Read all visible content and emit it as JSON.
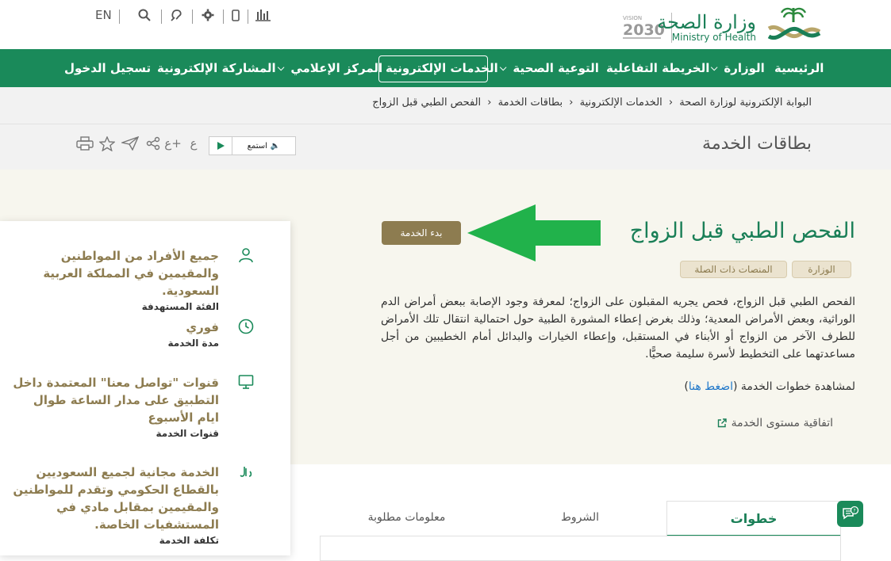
{
  "utility": {
    "lang": "EN",
    "icons": [
      "search-icon",
      "hearing-icon",
      "gear-icon",
      "mobile-icon",
      "stats-icon"
    ]
  },
  "logo": {
    "arabic": "وزارة الصحة",
    "english": "Ministry of Health",
    "vision": "VISION 2030"
  },
  "nav": {
    "items": [
      {
        "label": "الرئيسية"
      },
      {
        "label": "الوزارة"
      },
      {
        "label": "الخريطة التفاعلية"
      },
      {
        "label": "التوعية الصحية"
      },
      {
        "label": "الخدمات الإلكترونية"
      },
      {
        "label": "المركز الإعلامي"
      },
      {
        "label": "المشاركة الإلكترونية"
      },
      {
        "label": "تسجيل الدخول"
      }
    ]
  },
  "breadcrumb": {
    "items": [
      "البوابة الإلكترونية لوزارة الصحة",
      "الخدمات الإلكترونية",
      "بطاقات الخدمة",
      "الفحص الطبي قبل الزواج"
    ],
    "sep": "‹"
  },
  "page": {
    "title": "بطاقات الخدمة",
    "listen_label": "استمع"
  },
  "service": {
    "title": "الفحص الطبي قبل الزواج",
    "start_button": "بدء الخدمة",
    "tags": [
      "الوزارة",
      "المنصات ذات الصلة"
    ],
    "description": "الفحص الطبي قبل الزواج، فحص يجريه المقبلون على الزواج؛ لمعرفة وجود الإصابة ببعض أمراض الدم الوراثية، وبعض الأمراض المعدية؛ وذلك بغرض إعطاء المشورة الطبية حول احتمالية انتقال تلك الأمراض للطرف الآخر من الزواج أو الأبناء في المستقبل، وإعطاء الخيارات والبدائل أمام الخطيبين من أجل مساعدتهما على التخطيط لأسرة سليمة صحيًّا.",
    "steps_prefix": "لمشاهدة خطوات الخدمة (",
    "steps_link": "اضغط هنا",
    "steps_suffix": ")",
    "sla_label": "اتفاقية مستوى الخدمة"
  },
  "sidebar": {
    "items": [
      {
        "value": "جميع الأفراد من المواطنين والمقيمين في المملكة العربية السعودية.",
        "label": "الفئة المستهدفة"
      },
      {
        "value": "فوري",
        "label": "مدة الخدمة"
      },
      {
        "value": "قنوات \"تواصل معنا\" المعتمدة داخل التطبيق على مدار الساعة طوال ايام الأسبوع",
        "label": "قنوات الخدمة"
      },
      {
        "value": "الخدمة مجانية لجميع السعوديين بالقطاع الحكومي وتقدم للمواطنين والمقيمين بمقابل مادي في المستشفيات الخاصة.",
        "label": "تكلفة الخدمة"
      }
    ]
  },
  "tabs": [
    {
      "label": "خطوات"
    },
    {
      "label": "الشروط"
    },
    {
      "label": "معلومات مطلوبة"
    }
  ],
  "colors": {
    "primary_green": "#1a8a5a",
    "gold": "#8d7c50",
    "arrow_green": "#21b24b",
    "beige": "#f7f6ee"
  }
}
